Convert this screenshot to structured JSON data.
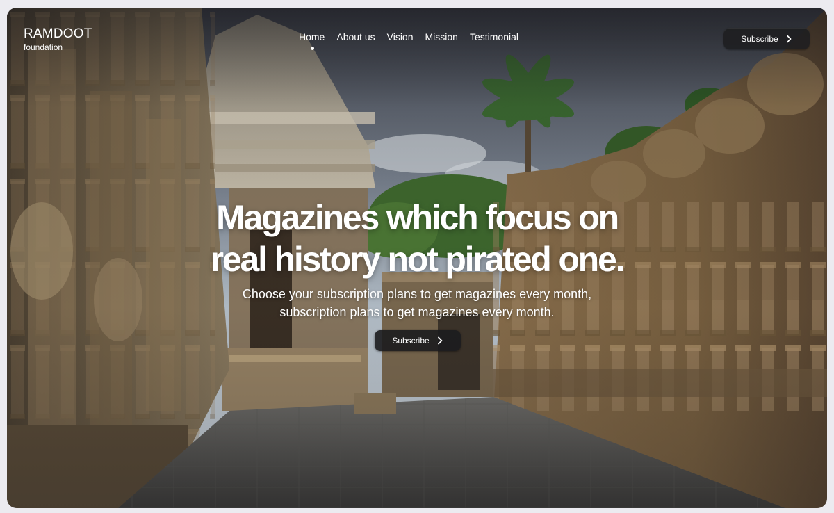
{
  "brand": {
    "name": "RAMDOOT",
    "tagline": "foundation"
  },
  "nav": {
    "items": [
      {
        "label": "Home",
        "active": true
      },
      {
        "label": "About us",
        "active": false
      },
      {
        "label": "Vision",
        "active": false
      },
      {
        "label": "Mission",
        "active": false
      },
      {
        "label": "Testimonial",
        "active": false
      }
    ],
    "subscribe_label": "Subscribe",
    "subscribe_icon": "chevron-right-icon"
  },
  "hero": {
    "title_line1": "Magazines which focus on",
    "title_line2": "real history not pirated one.",
    "subtitle_line1": "Choose your subscription plans to get magazines every month,",
    "subtitle_line2": "subscription plans to get magazines every month.",
    "cta_label": "Subscribe",
    "cta_icon": "chevron-right-icon"
  },
  "colors": {
    "text": "#ffffff",
    "button_bg": "#1e1e20",
    "page_bg": "#ecebf0"
  }
}
